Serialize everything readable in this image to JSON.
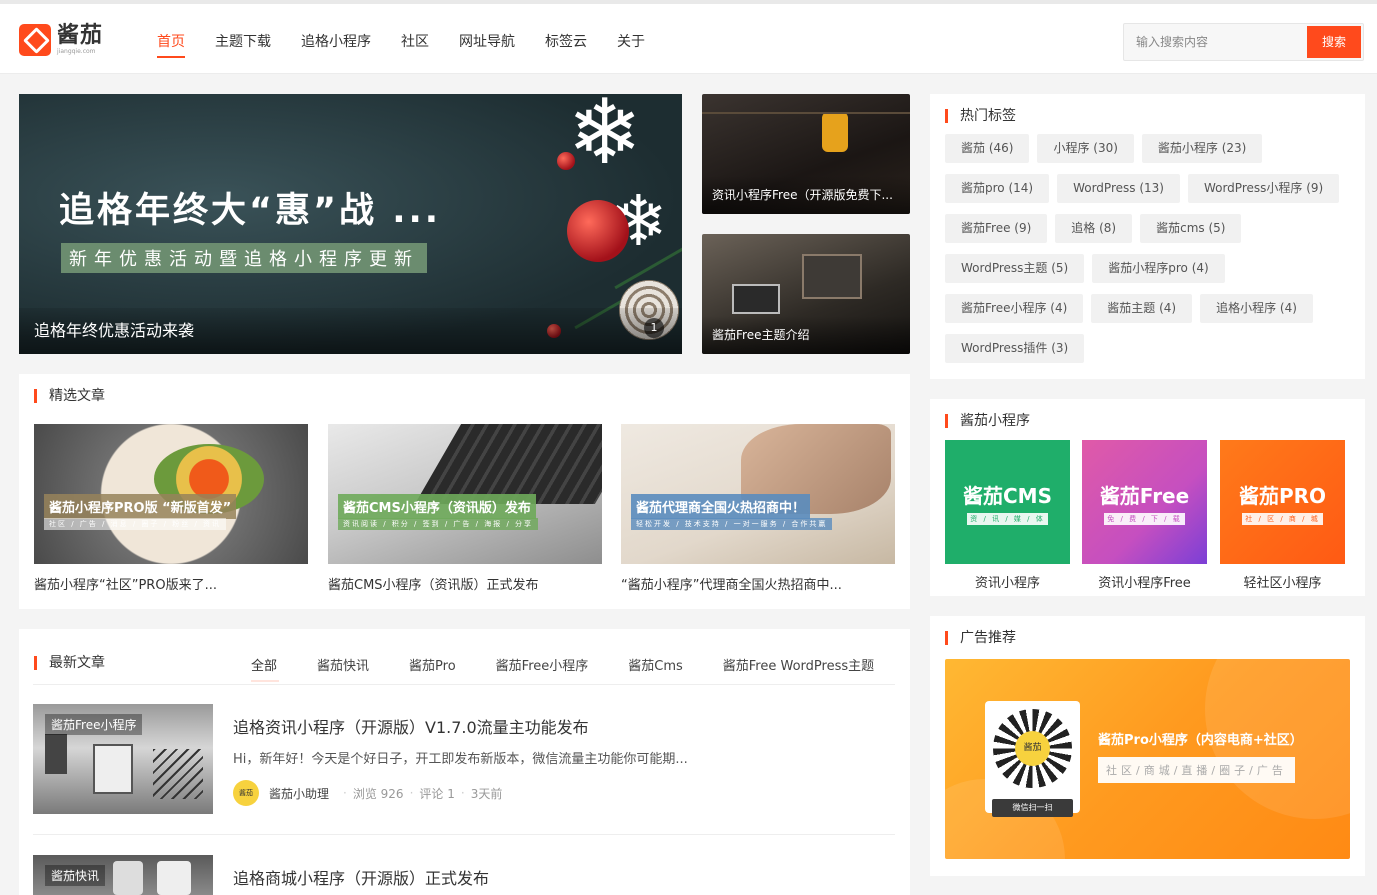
{
  "header": {
    "logo_cn": "酱茄",
    "logo_en": "jiangqie.com",
    "nav": [
      {
        "label": "首页",
        "active": true
      },
      {
        "label": "主题下载"
      },
      {
        "label": "追格小程序"
      },
      {
        "label": "社区"
      },
      {
        "label": "网址导航"
      },
      {
        "label": "标签云"
      },
      {
        "label": "关于"
      }
    ],
    "search": {
      "placeholder": "输入搜索内容",
      "button": "搜索"
    }
  },
  "hero": {
    "title": "追格年终大“惠”战 ...",
    "subtitle": "新年优惠活动暨追格小程序更新",
    "caption": "追格年终优惠活动来袭",
    "indicator": "1"
  },
  "side_slides": [
    {
      "caption": "资讯小程序Free（开源版免费下..."
    },
    {
      "caption": "酱茄Free主题介绍"
    }
  ],
  "featured": {
    "title": "精选文章",
    "items": [
      {
        "overlay": "酱茄小程序PRO版 “新版首发”",
        "overlay_sub": "社区 / 广告 / 消息 / 圈子 / 粉丝 / 资讯",
        "name": "酱茄小程序“社区”PRO版来了..."
      },
      {
        "overlay": "酱茄CMS小程序（资讯版）发布",
        "overlay_sub": "资讯阅读 / 积分 / 签到 / 广告 / 海报 / 分享",
        "name": "酱茄CMS小程序（资讯版）正式发布"
      },
      {
        "overlay": "酱茄代理商全国火热招商中！",
        "overlay_sub": "轻松开发 / 技术支持 / 一对一服务 / 合作共赢",
        "name": "“酱茄小程序”代理商全国火热招商中..."
      }
    ]
  },
  "latest": {
    "title": "最新文章",
    "tabs": [
      "全部",
      "酱茄快讯",
      "酱茄Pro",
      "酱茄Free小程序",
      "酱茄Cms",
      "酱茄Free WordPress主题"
    ],
    "posts": [
      {
        "badge": "酱茄Free小程序",
        "title": "追格资讯小程序（开源版）V1.7.0流量主功能发布",
        "excerpt": "Hi，新年好！今天是个好日子，开工即发布新版本，微信流量主功能你可能期...",
        "avatar": "酱茄",
        "author": "酱茄小助理",
        "views": "浏览 926",
        "comments": "评论 1",
        "time": "3天前"
      },
      {
        "badge": "酱茄快讯",
        "title": "追格商城小程序（开源版）正式发布"
      }
    ]
  },
  "hot_tags": {
    "title": "热门标签",
    "tags": [
      "酱茄 (46)",
      "小程序 (30)",
      "酱茄小程序 (23)",
      "酱茄pro (14)",
      "WordPress (13)",
      "WordPress小程序 (9)",
      "酱茄Free (9)",
      "追格 (8)",
      "酱茄cms (5)",
      "WordPress主题 (5)",
      "酱茄小程序pro (4)",
      "酱茄Free小程序 (4)",
      "酱茄主题 (4)",
      "追格小程序 (4)",
      "WordPress插件 (3)"
    ]
  },
  "mini_programs": {
    "title": "酱茄小程序",
    "items": [
      {
        "big": "酱茄CMS",
        "small": "资 / 讯 / 媒 / 体",
        "name": "资讯小程序",
        "color": "#1fae6a"
      },
      {
        "big": "酱茄Free",
        "small": "免 / 费 / 下 / 载",
        "name": "资讯小程序Free",
        "color": "#c54fc0"
      },
      {
        "big": "酱茄PRO",
        "small": "社 / 区 / 商 / 城",
        "name": "轻社区小程序",
        "color": "#ff5a14"
      }
    ]
  },
  "ad": {
    "title": "广告推荐",
    "qr_center": "酱茄",
    "qr_label": "微信扫一扫",
    "headline": "酱茄Pro小程序（内容电商+社区）",
    "sub": "社区/商城/直播/圈子/广告"
  },
  "colors": {
    "accent": "#ff4a1c"
  }
}
